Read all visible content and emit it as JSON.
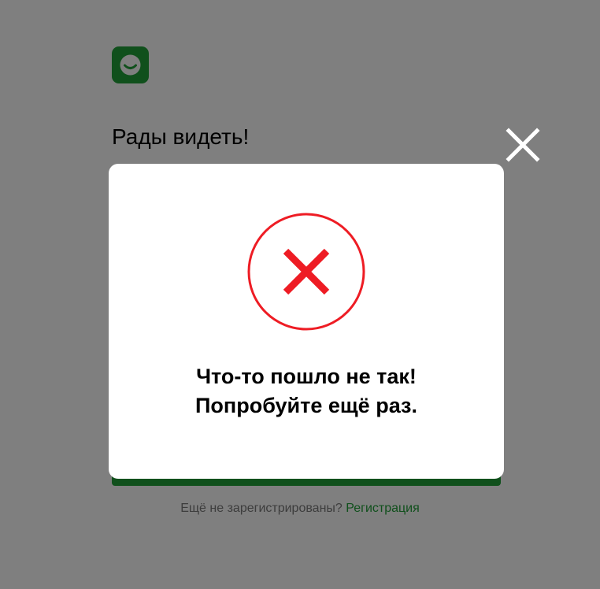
{
  "login": {
    "logo_icon": "smiley-logo-icon",
    "greeting": "Рады видеть!",
    "register_prompt": "Ещё не зарегистрированы?",
    "register_link": "Регистрация",
    "brand_color": "#21a038"
  },
  "modal": {
    "close_icon": "close-icon",
    "error_icon": "error-cross-icon",
    "error_color": "#ee1c24",
    "title_line1": "Что-то пошло не так!",
    "title_line2": "Попробуйте ещё раз."
  }
}
